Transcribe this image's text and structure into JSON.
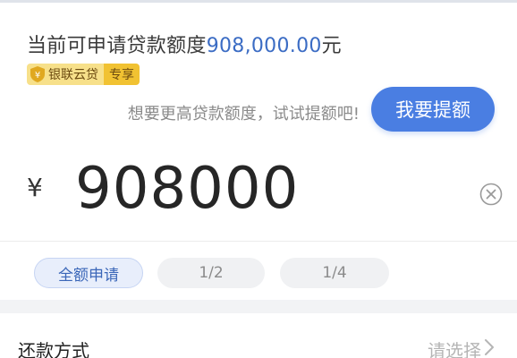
{
  "loan": {
    "limit_prefix": "当前可申请贷款额度",
    "limit_amount": "908,000.00",
    "limit_suffix": "元"
  },
  "badge": {
    "name": "银联云贷",
    "tag": "专享"
  },
  "raise": {
    "hint": "想要更高贷款额度，试试提额吧!",
    "button_label": "我要提额"
  },
  "amount": {
    "currency": "¥",
    "value": "908000"
  },
  "chips": [
    {
      "label": "全额申请",
      "selected": true
    },
    {
      "label": "1/2",
      "selected": false
    },
    {
      "label": "1/4",
      "selected": false
    }
  ],
  "repayment": {
    "label": "还款方式",
    "value": "请选择"
  },
  "colors": {
    "accent": "#4a7ee2",
    "amount_highlight": "#3b6cc4",
    "badge_gold": "#f1c232"
  },
  "icons": {
    "badge": "shield-icon",
    "clear": "clear-circle-icon",
    "chevron": "chevron-right-icon"
  }
}
